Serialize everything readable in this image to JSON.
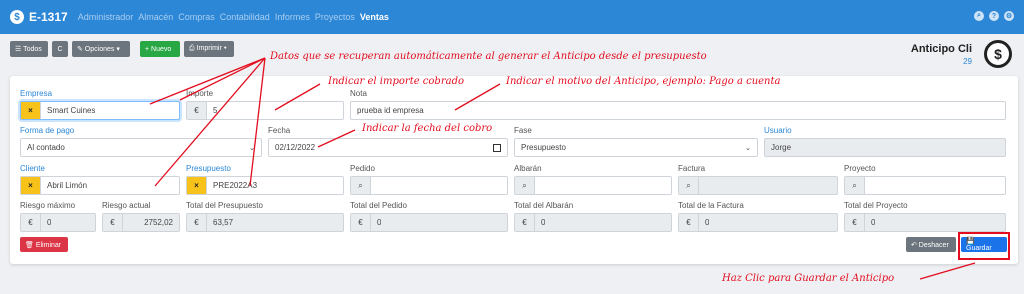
{
  "app": {
    "title": "E-1317",
    "logo_glyph": "$"
  },
  "nav": [
    "Administrador",
    "Almacén",
    "Compras",
    "Contabilidad",
    "Informes",
    "Proyectos",
    "Ventas"
  ],
  "toolbar": {
    "todos": "☰ Todos",
    "refresh": "C",
    "opciones": "✎ Opciones ▾",
    "nuevo": "+ Nuevo",
    "imprimir": "⎙ Imprimir ▾"
  },
  "page": {
    "title": "Anticipo Cli",
    "count": "29",
    "icon": "$"
  },
  "form": {
    "empresa_label": "Empresa",
    "empresa_value": "Smart Cuines",
    "importe_label": "Importe",
    "importe_value": "5",
    "nota_label": "Nota",
    "nota_value": "prueba id empresa",
    "forma_pago_label": "Forma de pago",
    "forma_pago_value": "Al contado",
    "fecha_label": "Fecha",
    "fecha_value": "02/12/2022",
    "fase_label": "Fase",
    "fase_value": "Presupuesto",
    "usuario_label": "Usuario",
    "usuario_value": "Jorge",
    "cliente_label": "Cliente",
    "cliente_value": "Abril Limón",
    "presupuesto_label": "Presupuesto",
    "presupuesto_value": "PRE2022A3",
    "pedido_label": "Pedido",
    "albaran_label": "Albarán",
    "factura_label": "Factura",
    "proyecto_label": "Proyecto",
    "riesgo_max_label": "Riesgo máximo",
    "riesgo_max_value": "0",
    "riesgo_act_label": "Riesgo actual",
    "riesgo_act_value": "2752,02",
    "total_presupuesto_label": "Total del Presupuesto",
    "total_presupuesto_value": "63,57",
    "total_pedido_label": "Total del Pedido",
    "total_pedido_value": "0",
    "total_albaran_label": "Total del Albarán",
    "total_albaran_value": "0",
    "total_factura_label": "Total de la Factura",
    "total_factura_value": "0",
    "total_proyecto_label": "Total del Proyecto",
    "total_proyecto_value": "0",
    "currency": "€",
    "clear_glyph": "×",
    "search_glyph": "⌕"
  },
  "buttons": {
    "eliminar": "🗑 Eliminar",
    "deshacer": "↶ Deshacer",
    "guardar": "💾 Guardar"
  },
  "annotations": {
    "datos": "Datos que se recuperan automáticamente al generar el Anticipo desde el presupuesto",
    "importe": "Indicar el importe cobrado",
    "motivo": "Indicar el motivo del Anticipo, ejemplo: Pago a cuenta",
    "fecha": "Indicar la fecha del cobro",
    "guardar": "Haz Clic para Guardar el Anticipo"
  },
  "colors": {
    "accent": "#2c87d6",
    "annotation": "#e30d1f",
    "clear_button": "#f7c21a",
    "delete": "#dc3545",
    "save": "#1a73e8"
  }
}
